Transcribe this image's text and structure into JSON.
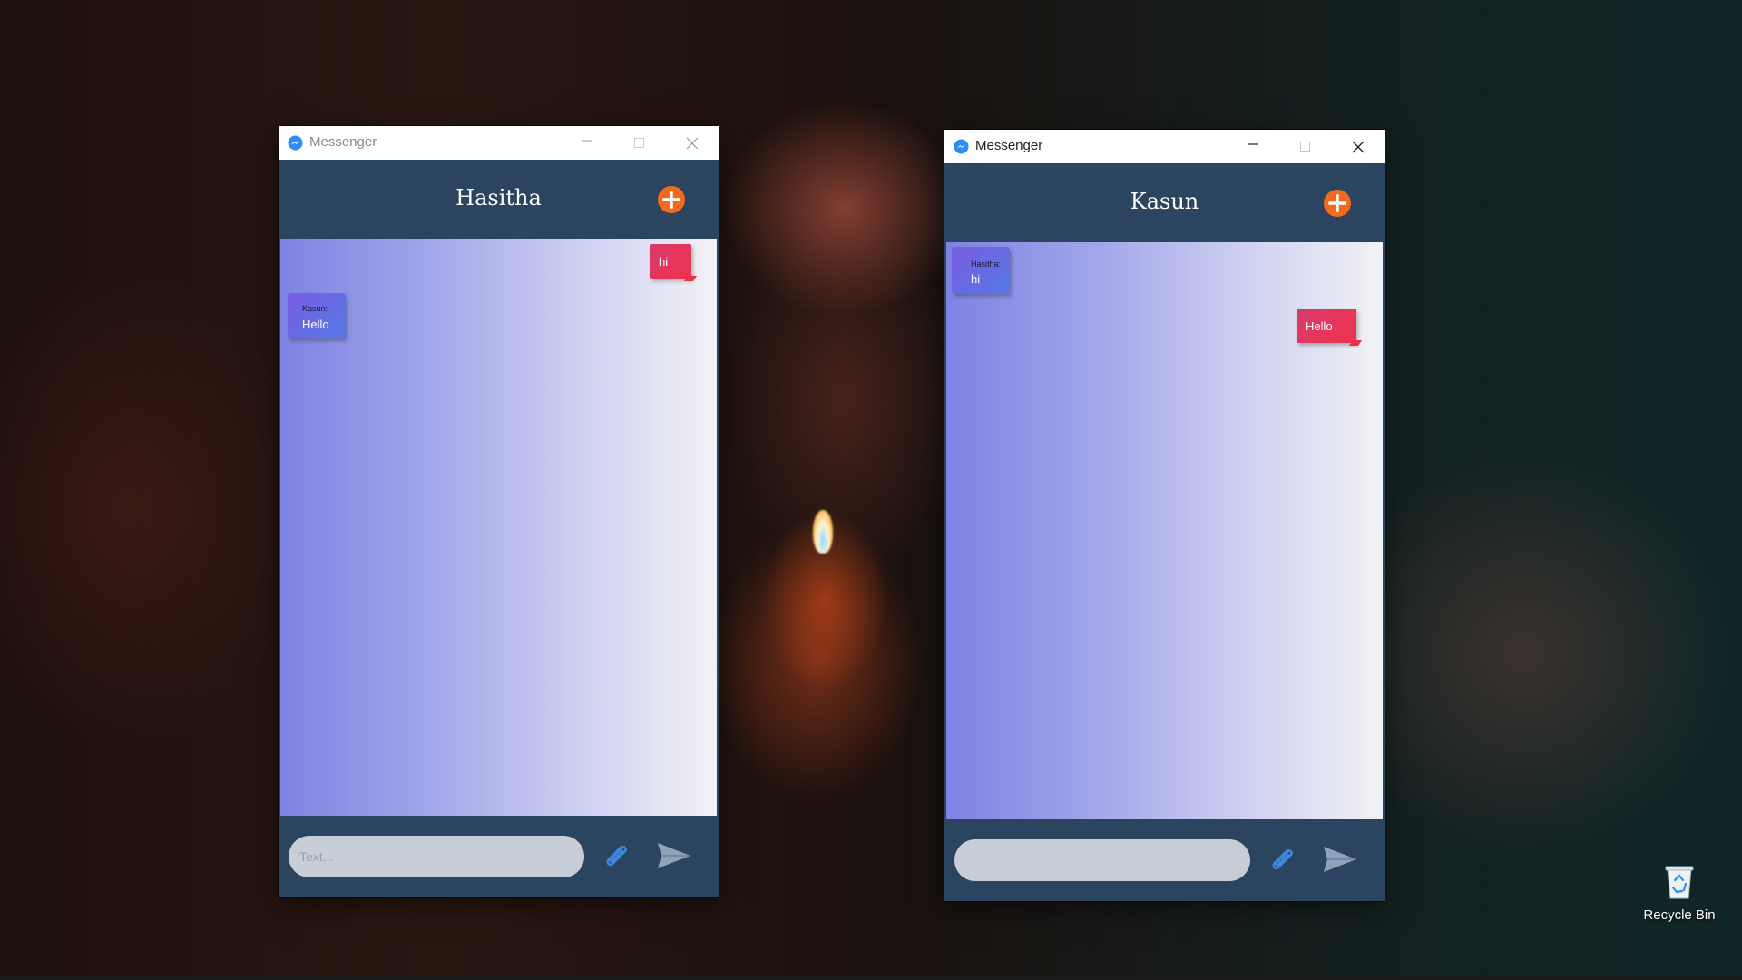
{
  "desktop": {
    "recycle_bin_label": "Recycle Bin"
  },
  "windows": [
    {
      "app_title": "Messenger",
      "chat_name": "Hasitha",
      "input_placeholder": "Text...",
      "input_value": "",
      "messages": [
        {
          "direction": "sent",
          "sender": "",
          "text": "hi"
        },
        {
          "direction": "received",
          "sender": "Kasun:",
          "text": "Hello"
        }
      ]
    },
    {
      "app_title": "Messenger",
      "chat_name": "Kasun",
      "input_placeholder": "",
      "input_value": "",
      "messages": [
        {
          "direction": "received",
          "sender": "Hasitha:",
          "text": "hi"
        },
        {
          "direction": "sent",
          "sender": "",
          "text": "Hello"
        }
      ]
    }
  ],
  "icons": {
    "app": "messenger-icon",
    "add": "plus-circle-icon",
    "attach": "paperclip-icon",
    "send": "paper-plane-icon",
    "minimize": "minimize-icon",
    "maximize": "maximize-icon",
    "close": "close-icon",
    "recycle_bin": "recycle-bin-icon"
  },
  "colors": {
    "header": "#2b4560",
    "accent_add": "#f46a1d",
    "sent_bubble": "#e8334b",
    "received_bubble": "#6a6ae4",
    "input_bg": "#c8ced8"
  }
}
